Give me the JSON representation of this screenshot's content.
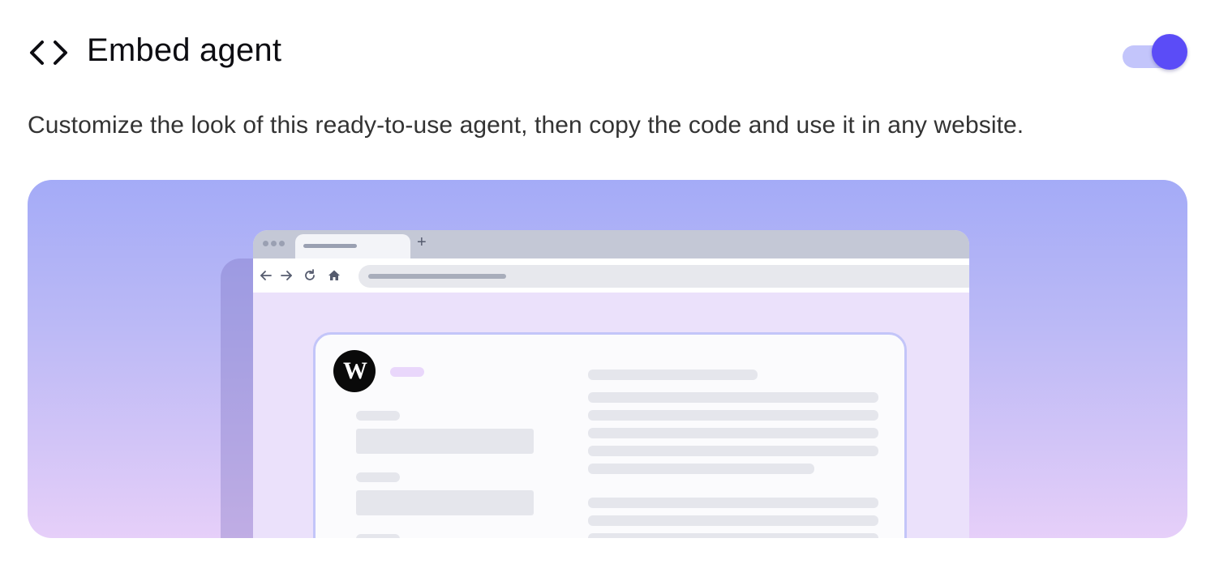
{
  "header": {
    "title": "Embed agent",
    "icon": "code-brackets-icon",
    "toggle": {
      "enabled": true,
      "track_color": "#c3c5fb",
      "knob_color": "#5b4cf7"
    }
  },
  "description": "Customize the look of this ready-to-use agent, then copy the code and use it in any website.",
  "preview": {
    "gradient": [
      "#a4abf7",
      "#e6cff9"
    ],
    "browser": {
      "new_tab_symbol": "+",
      "nav_icons": [
        "back-arrow-icon",
        "forward-arrow-icon",
        "reload-icon",
        "home-icon"
      ]
    },
    "widget": {
      "logo_text": "W",
      "accent_color": "#c3c5f9"
    }
  }
}
